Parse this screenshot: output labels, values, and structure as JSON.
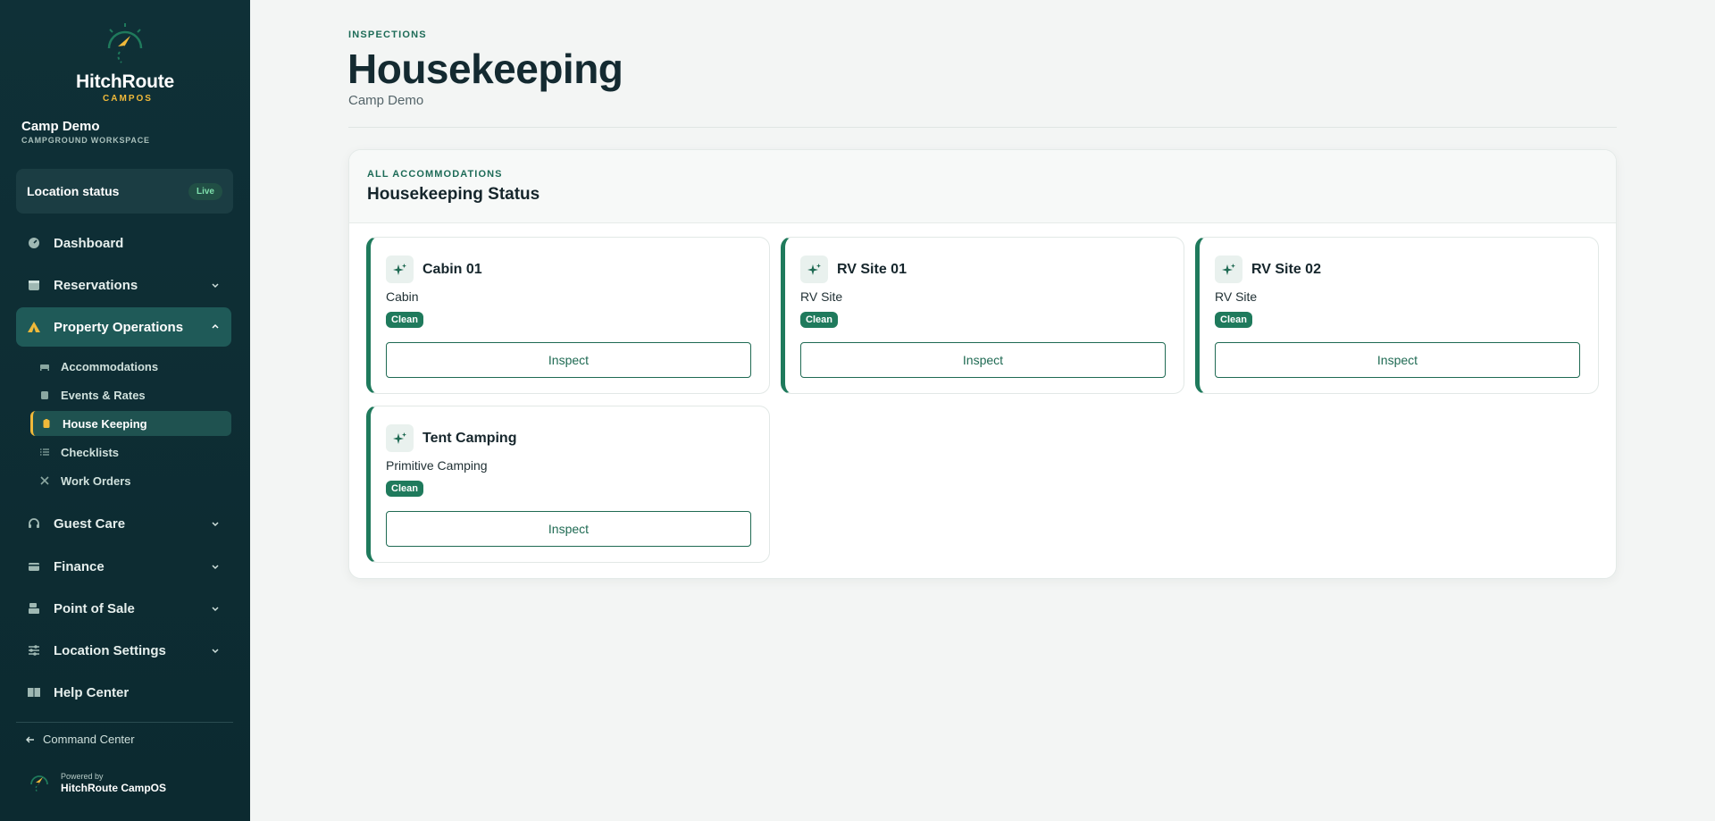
{
  "brand": {
    "name": "HitchRoute",
    "sub": "CAMPOS"
  },
  "workspace": {
    "name": "Camp Demo",
    "subtitle": "CAMPGROUND WORKSPACE"
  },
  "location_status": {
    "label": "Location status",
    "badge": "Live"
  },
  "nav": {
    "dashboard": "Dashboard",
    "reservations": "Reservations",
    "property_operations": "Property Operations",
    "guest_care": "Guest Care",
    "finance": "Finance",
    "point_of_sale": "Point of Sale",
    "location_settings": "Location Settings",
    "help_center": "Help Center"
  },
  "subnav": {
    "accommodations": "Accommodations",
    "events_rates": "Events & Rates",
    "house_keeping": "House Keeping",
    "checklists": "Checklists",
    "work_orders": "Work Orders"
  },
  "command_center": "Command Center",
  "powered": {
    "small": "Powered by",
    "big": "HitchRoute CampOS"
  },
  "page": {
    "eyebrow": "INSPECTIONS",
    "title": "Housekeeping",
    "subtitle": "Camp Demo"
  },
  "panel": {
    "eyebrow": "ALL ACCOMMODATIONS",
    "title": "Housekeeping Status"
  },
  "cards": [
    {
      "title": "Cabin 01",
      "type": "Cabin",
      "status": "Clean",
      "action": "Inspect"
    },
    {
      "title": "RV Site 01",
      "type": "RV Site",
      "status": "Clean",
      "action": "Inspect"
    },
    {
      "title": "RV Site 02",
      "type": "RV Site",
      "status": "Clean",
      "action": "Inspect"
    },
    {
      "title": "Tent Camping",
      "type": "Primitive Camping",
      "status": "Clean",
      "action": "Inspect"
    }
  ],
  "colors": {
    "sidebar": "#0f3037",
    "accent": "#1f7a5c",
    "brand_gold": "#f0b93a",
    "page_bg": "#f3f5f4"
  }
}
